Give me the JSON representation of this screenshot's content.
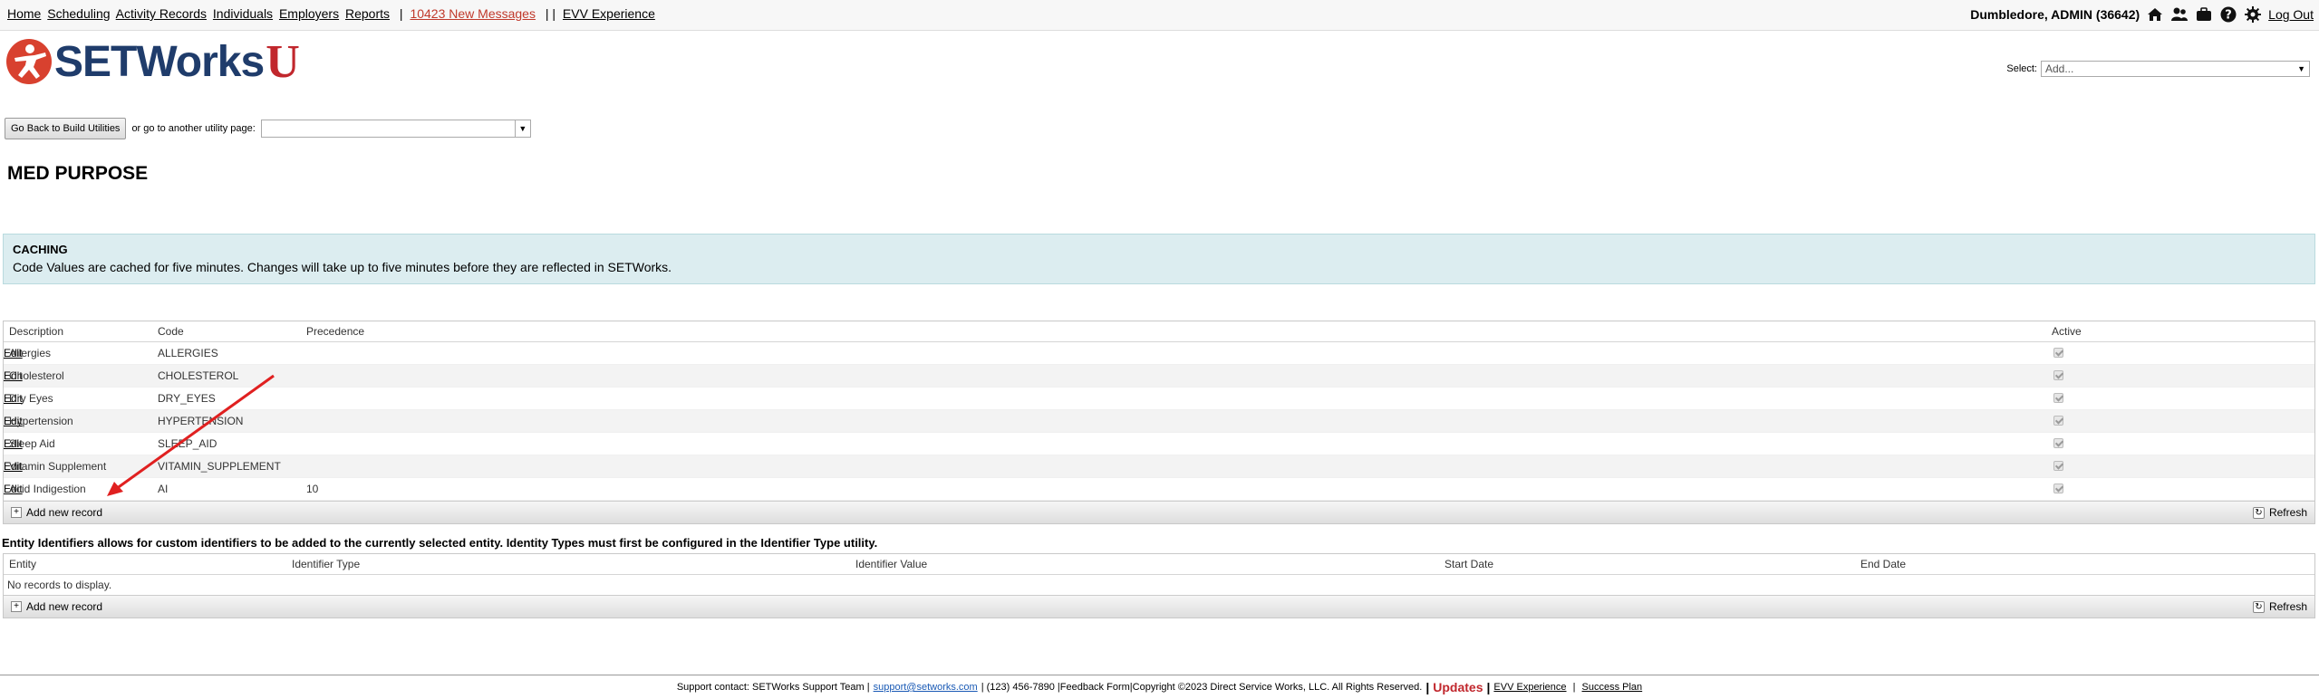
{
  "nav": {
    "links": [
      "Home",
      "Scheduling",
      "Activity Records",
      "Individuals",
      "Employers",
      "Reports"
    ],
    "messages": "10423 New Messages",
    "separator": "| |",
    "evv": "EVV Experience",
    "user": "Dumbledore, ADMIN (36642)",
    "logout": "Log Out",
    "icons": [
      "home-icon",
      "users-icon",
      "briefcase-icon",
      "help-icon",
      "settings-icon"
    ]
  },
  "logo": {
    "text": "SETWorks",
    "accent": "U",
    "brand_color": "#1f3c6b",
    "accent_color": "#c1272d"
  },
  "select": {
    "label": "Select:",
    "value": "Add..."
  },
  "utility": {
    "back_button": "Go Back to Build Utilities",
    "or_text": "or go to another utility page:"
  },
  "page_title": "MED PURPOSE",
  "caching": {
    "heading": "CACHING",
    "text": "Code Values are cached for five minutes. Changes will take up to five minutes before they are reflected in SETWorks."
  },
  "grid1": {
    "columns": [
      "Description",
      "Code",
      "Precedence",
      "Active"
    ],
    "rows": [
      {
        "description": "Allergies",
        "code": "ALLERGIES",
        "precedence": "",
        "edit": "Edit"
      },
      {
        "description": "Cholesterol",
        "code": "CHOLESTEROL",
        "precedence": "",
        "edit": "Edit"
      },
      {
        "description": "Dry Eyes",
        "code": "DRY_EYES",
        "precedence": "",
        "edit": "Edit"
      },
      {
        "description": "Hypertension",
        "code": "HYPERTENSION",
        "precedence": "",
        "edit": "Edit"
      },
      {
        "description": "Sleep Aid",
        "code": "SLEEP_AID",
        "precedence": "",
        "edit": "Edit"
      },
      {
        "description": "Vitamin Supplement",
        "code": "VITAMIN_SUPPLEMENT",
        "precedence": "",
        "edit": "Edit"
      },
      {
        "description": "Acid Indigestion",
        "code": "AI",
        "precedence": "10",
        "edit": "Edit"
      }
    ],
    "add_label": "Add new record",
    "refresh_label": "Refresh"
  },
  "entity": {
    "description": "Entity Identifiers allows for custom identifiers to be added to the currently selected entity. Identity Types must first be configured in the Identifier Type utility.",
    "columns": [
      "Entity",
      "Identifier Type",
      "Identifier Value",
      "Start Date",
      "End Date"
    ],
    "no_records": "No records to display.",
    "add_label": "Add new record",
    "refresh_label": "Refresh"
  },
  "footer": {
    "support": "Support contact: SETWorks Support Team |",
    "email": "support@setworks.com",
    "rest": "| (123) 456-7890 |Feedback Form|Copyright ©2023 Direct Service Works, LLC. All Rights Reserved.",
    "updates": "Updates",
    "evv": "EVV Experience",
    "success": "Success Plan"
  }
}
